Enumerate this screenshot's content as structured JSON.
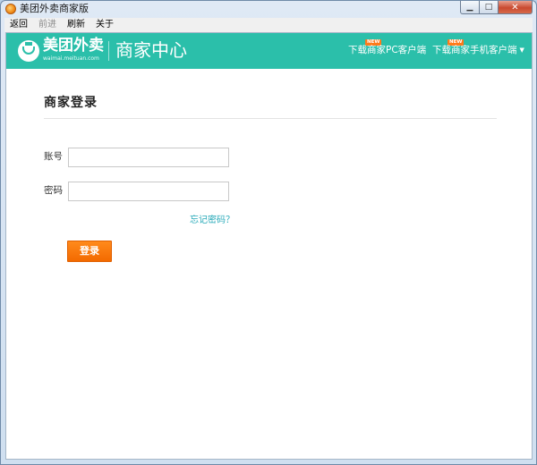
{
  "window": {
    "title": "美团外卖商家版",
    "controls": {
      "minimize_icon": "minimize-icon",
      "maximize_icon": "maximize-icon",
      "close_icon": "close-icon"
    }
  },
  "menubar": {
    "items": [
      {
        "label": "返回",
        "enabled": true
      },
      {
        "label": "前进",
        "enabled": false
      },
      {
        "label": "刷新",
        "enabled": true
      },
      {
        "label": "关于",
        "enabled": true
      }
    ]
  },
  "header": {
    "logo_text": "美团外卖",
    "logo_sub": "waimai.meituan.com",
    "title": "商家中心",
    "links": [
      {
        "label": "下载商家PC客户端",
        "badge": "NEW"
      },
      {
        "label": "下载商家手机客户端",
        "badge": "NEW",
        "caret": "▼"
      }
    ],
    "accent_color": "#2bbfaa",
    "badge_color": "#ff7a1a"
  },
  "login": {
    "title": "商家登录",
    "account_label": "账号",
    "account_value": "",
    "password_label": "密码",
    "password_value": "",
    "forgot_link": "忘记密码？",
    "submit_label": "登录",
    "submit_color": "#f36a00"
  }
}
